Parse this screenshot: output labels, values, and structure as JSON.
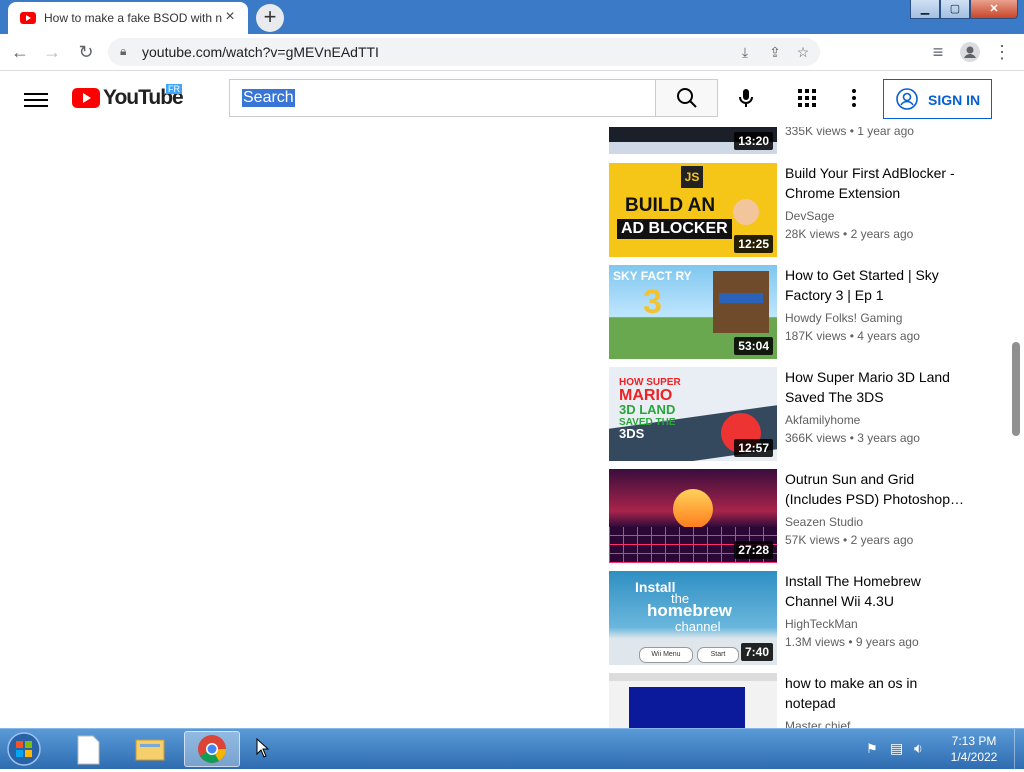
{
  "browser": {
    "tab_title": "How to make a fake BSOD with n",
    "tab_close": "×",
    "new_tab": "+",
    "url": "youtube.com/watch?v=gMEVnEAdTTI",
    "window_buttons": {
      "minimize": "▁",
      "maximize": "▢",
      "close": "✕"
    }
  },
  "youtube": {
    "logo_text": "YouTube",
    "logo_region": "FR",
    "search_placeholder": "Search",
    "sign_in": "SIGN IN"
  },
  "recommendations": [
    {
      "title": "",
      "channel": "",
      "views": "335K views",
      "age": "1 year ago",
      "duration": "13:20"
    },
    {
      "title": "Build Your First AdBlocker - Chrome Extension",
      "channel": "DevSage",
      "views": "28K views",
      "age": "2 years ago",
      "duration": "12:25",
      "thumb_text": [
        "BUILD AN",
        "AD BLOCKER",
        "JS"
      ]
    },
    {
      "title": "How to Get Started | Sky Factory 3 | Ep 1",
      "channel": "Howdy Folks! Gaming",
      "views": "187K views",
      "age": "4 years ago",
      "duration": "53:04",
      "thumb_text": [
        "SKY FACT RY",
        "3"
      ]
    },
    {
      "title": "How Super Mario 3D Land Saved The 3DS",
      "channel": "Akfamilyhome",
      "views": "366K views",
      "age": "3 years ago",
      "duration": "12:57",
      "thumb_text": [
        "HOW SUPER",
        "MARIO",
        "3D LAND",
        "SAVED THE",
        "3DS"
      ]
    },
    {
      "title": "Outrun Sun and Grid (Includes PSD) Photoshop…",
      "channel": "Seazen Studio",
      "views": "57K views",
      "age": "2 years ago",
      "duration": "27:28"
    },
    {
      "title": "Install The Homebrew Channel Wii 4.3U",
      "channel": "HighTeckMan",
      "views": "1.3M views",
      "age": "9 years ago",
      "duration": "7:40",
      "thumb_text": [
        "Install",
        "the",
        "homebrew",
        "channel",
        "Wii Menu",
        "Start"
      ]
    },
    {
      "title": "how to make an os in notepad",
      "channel": "Master chief",
      "views": "",
      "age": "",
      "duration": ""
    }
  ],
  "taskbar": {
    "time": "7:13 PM",
    "date": "1/4/2022"
  }
}
